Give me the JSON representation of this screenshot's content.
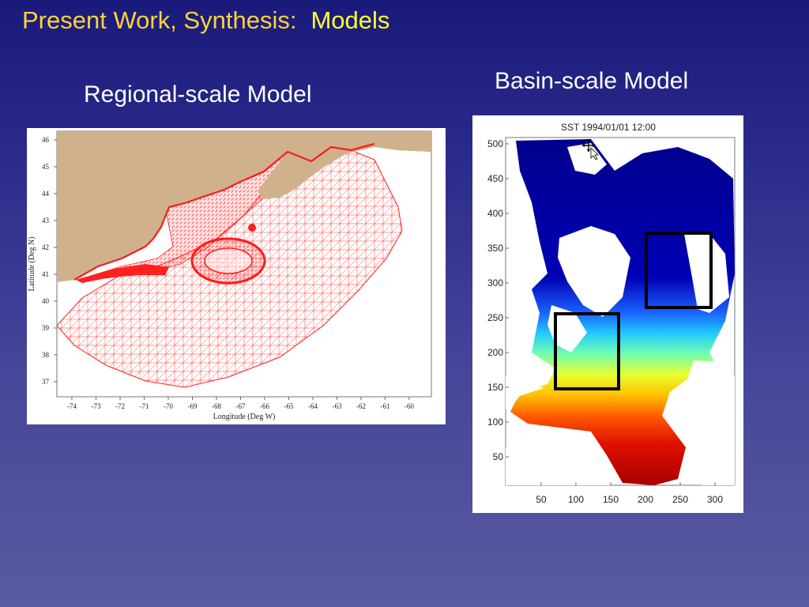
{
  "slide": {
    "title_main": "Present Work, Synthesis:",
    "title_accent": "Models"
  },
  "regional": {
    "label": "Regional-scale Model",
    "xlabel": "Longitude (Deg W)",
    "ylabel": "Latitude (Deg N)",
    "x_ticks": [
      "-74",
      "-73",
      "-72",
      "-71",
      "-70",
      "-69",
      "-68",
      "-67",
      "-66",
      "-65",
      "-64",
      "-63",
      "-62",
      "-61",
      "-60"
    ],
    "y_ticks": [
      "46",
      "45",
      "44",
      "43",
      "42",
      "41",
      "40",
      "39",
      "38",
      "37"
    ]
  },
  "basin": {
    "label": "Basin-scale Model",
    "plot_title": "SST 1994/01/01 12:00",
    "x_ticks": [
      "50",
      "100",
      "150",
      "200",
      "250",
      "300"
    ],
    "y_ticks": [
      "500",
      "450",
      "400",
      "350",
      "300",
      "250",
      "200",
      "150",
      "100",
      "50"
    ]
  },
  "colors": {
    "mesh": "#ff2020",
    "land": "#cfb18c",
    "title": "#ffd23a",
    "accent": "#ffff33"
  }
}
